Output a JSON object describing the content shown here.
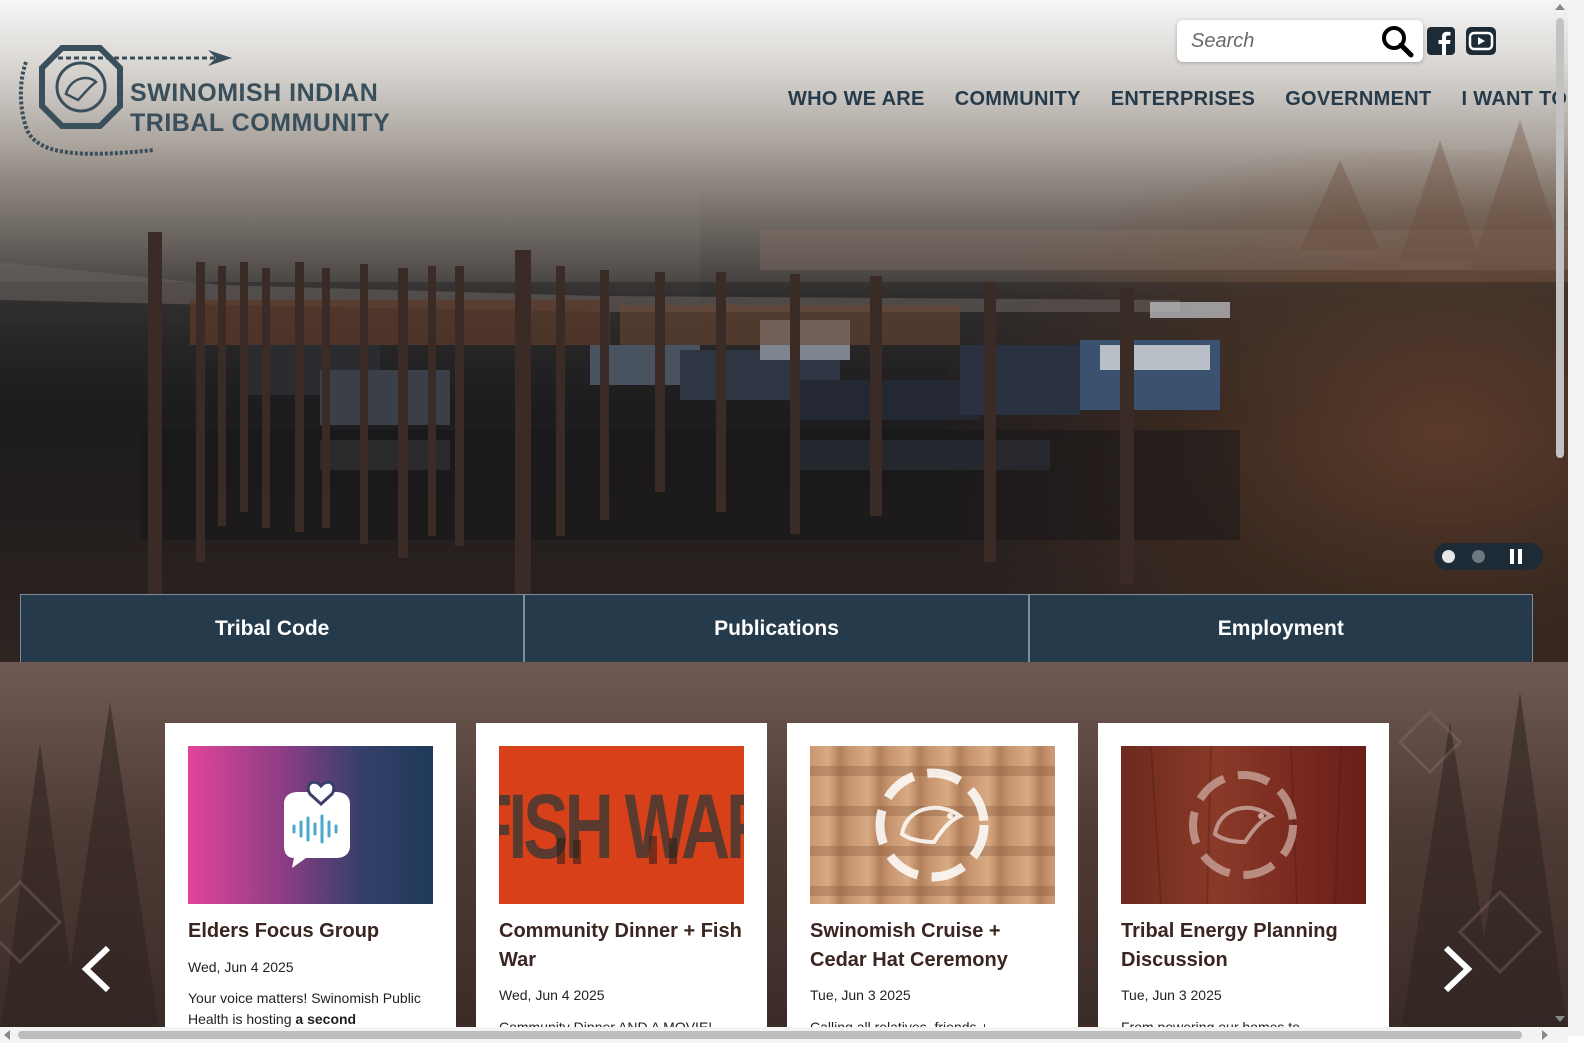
{
  "header": {
    "logo_line1": "SWINOMISH INDIAN",
    "logo_line2": "TRIBAL COMMUNITY",
    "search_placeholder": "Search"
  },
  "nav": {
    "items": [
      "WHO WE ARE",
      "COMMUNITY",
      "ENTERPRISES",
      "GOVERNMENT",
      "I WANT TO..."
    ]
  },
  "hero": {
    "slide_count": 2,
    "active_slide": 1
  },
  "quick_links": [
    "Tribal Code",
    "Publications",
    "Employment"
  ],
  "events": [
    {
      "title": "Elders Focus Group",
      "date": "Wed, Jun 4 2025",
      "desc_start": "Your voice matters! Swinomish Public Health is hosting ",
      "desc_bold": "a second",
      "image": "speech-bubble-heart-icon"
    },
    {
      "title": "Community Dinner + Fish War",
      "date": "Wed, Jun 4 2025",
      "desc": "Community Dinner AND A MOVIE!",
      "image_text": "FISH WAR"
    },
    {
      "title": "Swinomish Cruise + Cedar Hat Ceremony",
      "date": "Tue, Jun 3 2025",
      "desc": "Calling all relatives, friends +",
      "image": "salmon-emblem-icon"
    },
    {
      "title": "Tribal Energy Planning Discussion",
      "date": "Tue, Jun 3 2025",
      "desc": "From powering our homes to",
      "image": "salmon-emblem-icon"
    }
  ],
  "colors": {
    "navy": "#253a4b",
    "logo": "#3a4f5c",
    "card_title": "#3a2520",
    "fishwar_red": "#d8401a"
  }
}
